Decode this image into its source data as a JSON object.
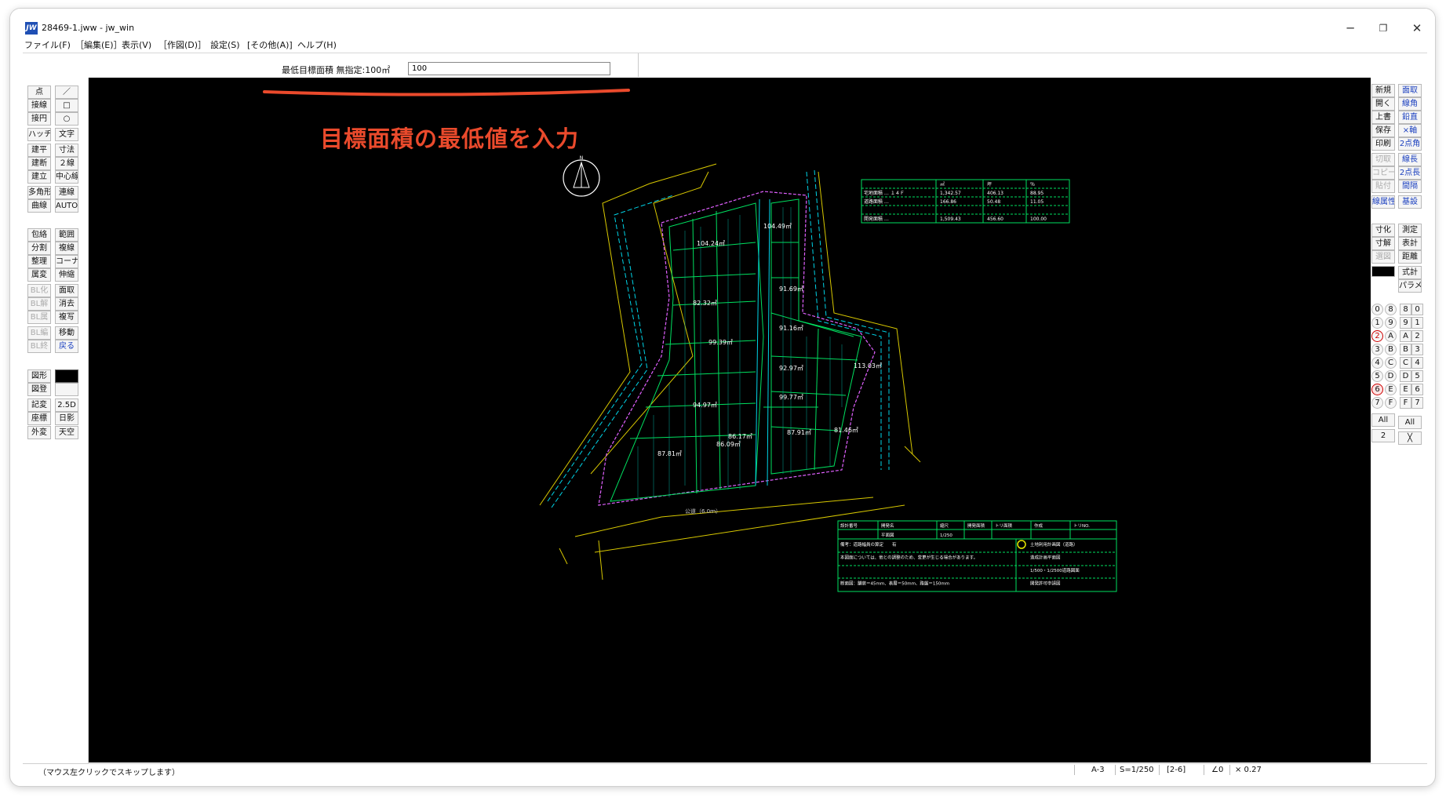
{
  "window": {
    "title": "28469-1.jww - jw_win",
    "icon_label": "JW"
  },
  "window_controls": {
    "minimize": "─",
    "restore": "❐",
    "close": "✕"
  },
  "menu": [
    "ファイル(F)",
    "［編集(E)］",
    "表示(V)",
    "［作図(D)］",
    "設定(S)",
    "[その他(A)]",
    "ヘルプ(H)"
  ],
  "control_bar": {
    "label": "最低目標面積 無指定:100㎡",
    "input_value": "100"
  },
  "left_tools": [
    [
      "点",
      "／"
    ],
    [
      "接線",
      "□"
    ],
    [
      "接円",
      "○"
    ],
    [
      "ハッチ",
      "文字"
    ],
    [
      "建平",
      "寸法"
    ],
    [
      "建断",
      "２線"
    ],
    [
      "建立",
      "中心線"
    ],
    [
      "多角形",
      "連線"
    ],
    [
      "曲線",
      "AUTO"
    ],
    [
      "包絡",
      "範囲"
    ],
    [
      "分割",
      "複線"
    ],
    [
      "整理",
      "コーナー"
    ],
    [
      "属変",
      "伸縮"
    ],
    [
      "BL化",
      "面取"
    ],
    [
      "BL解",
      "消去"
    ],
    [
      "BL属",
      "複写"
    ],
    [
      "BL編",
      "移動"
    ],
    [
      "BL終",
      "戻る"
    ],
    [
      "図形",
      ""
    ],
    [
      "図登",
      ""
    ],
    [
      "記変",
      "2.5D"
    ],
    [
      "座標",
      "日影"
    ],
    [
      "外変",
      "天空"
    ]
  ],
  "right_tools": [
    [
      "新規",
      "面取"
    ],
    [
      "開く",
      "線角"
    ],
    [
      "上書",
      "鉛直"
    ],
    [
      "保存",
      "×軸"
    ],
    [
      "印刷",
      "2点角"
    ],
    [
      "切取",
      "線長"
    ],
    [
      "コピー",
      "2点長"
    ],
    [
      "貼付",
      "間隔"
    ],
    [
      "線属性",
      "基設"
    ],
    [
      "寸化",
      "測定"
    ],
    [
      "寸解",
      "表計"
    ],
    [
      "選図",
      "距離"
    ],
    [
      "",
      "式計"
    ],
    [
      "",
      "パラメ"
    ]
  ],
  "layer_groups": {
    "layers": [
      "0",
      "1",
      "2",
      "3",
      "4",
      "5",
      "6",
      "7",
      "8",
      "9",
      "A",
      "B",
      "C",
      "D",
      "E",
      "F"
    ],
    "groups": [
      "8",
      "9",
      "A",
      "B",
      "C",
      "D",
      "E",
      "F",
      "0",
      "1",
      "2",
      "3",
      "4",
      "5",
      "6",
      "7"
    ],
    "all": "All",
    "scale_btn": "2"
  },
  "annotation": {
    "text": "目標面積の最低値を入力",
    "color": "#ea4a2c"
  },
  "drawing": {
    "lot_areas": [
      "104.24㎡",
      "104.49㎡",
      "82.32㎡",
      "91.69㎡",
      "91.16㎡",
      "99.39㎡",
      "92.97㎡",
      "113.03㎡",
      "94.97㎡",
      "99.77㎡",
      "87.81㎡",
      "86.09㎡",
      "86.17㎡",
      "87.91㎡",
      "81.46㎡"
    ],
    "road_label": "公道（6.0ｍ）",
    "table_top_rows": [
      [
        "宅地面積 … １４Ｆ",
        "1,342.57",
        "406.13",
        "88.95"
      ],
      [
        "道路面積 …",
        "166.86",
        "50.48",
        "11.05"
      ],
      [
        "",
        "",
        "",
        ""
      ],
      [
        "開発面積 …",
        "1,509.43",
        "456.60",
        "100.00"
      ]
    ],
    "table_top_header": [
      "",
      "㎡",
      "坪",
      "％"
    ],
    "title_block": {
      "r1": [
        "設計番号",
        "開発名",
        "縮尺",
        "開発面積",
        "トリ面積",
        "作成",
        "トリNO."
      ],
      "r2": [
        "",
        "平面図",
        "1/250",
        "",
        "",
        "",
        ""
      ],
      "legend": [
        "土地利用計画図（道路）",
        "造成計画平面図",
        "1/500・1/2500道路図面",
        "開発許可申請図"
      ],
      "notes": [
        "備考：道路幅員の算定　　有",
        "本図面については、他との調整のため、変更が生じる場合があります。",
        "",
        "断面図：舗装＝45mm、表層＝50mm、路盤＝150mm"
      ]
    },
    "north_mark": "N"
  },
  "status": {
    "message": "（マウス左クリックでスキップします）",
    "paper": "A-3",
    "scale": "S=1/250",
    "layer": "[2-6]",
    "angle": "∠0",
    "factor": "× 0.27"
  }
}
